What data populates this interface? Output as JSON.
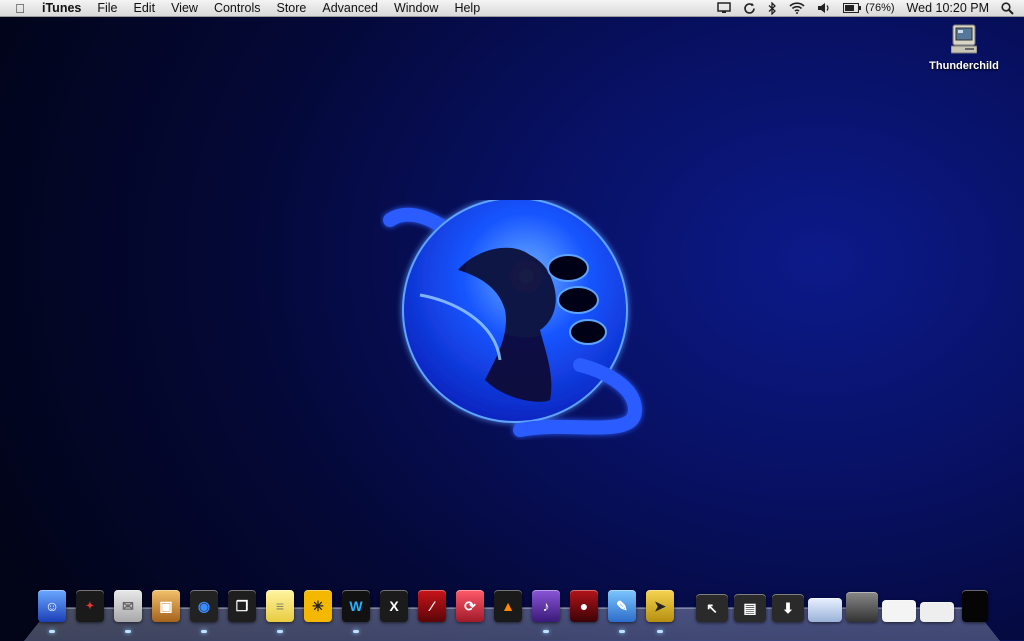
{
  "menubar": {
    "app_name": "iTunes",
    "items": [
      "File",
      "Edit",
      "View",
      "Controls",
      "Store",
      "Advanced",
      "Window",
      "Help"
    ],
    "battery": "(76%)",
    "clock": "Wed 10:20 PM"
  },
  "desktop": {
    "drive_label": "Thunderchild"
  },
  "dock": {
    "apps": [
      "finder-icon",
      "dashboard-icon",
      "mail-icon",
      "photos-icon",
      "chrome-icon",
      "spaces-icon",
      "notes-icon",
      "pinwheel-icon",
      "word-icon",
      "x-app-icon",
      "book-icon",
      "sync-icon",
      "vlc-icon",
      "podcast-icon",
      "recorder-icon",
      "xcode-icon",
      "bird-icon"
    ],
    "stacks": [
      "applications-stack-icon",
      "documents-stack-icon",
      "downloads-stack-icon",
      "window-thumb-1",
      "window-thumb-2",
      "window-thumb-3",
      "window-thumb-4",
      "trash-icon"
    ]
  }
}
